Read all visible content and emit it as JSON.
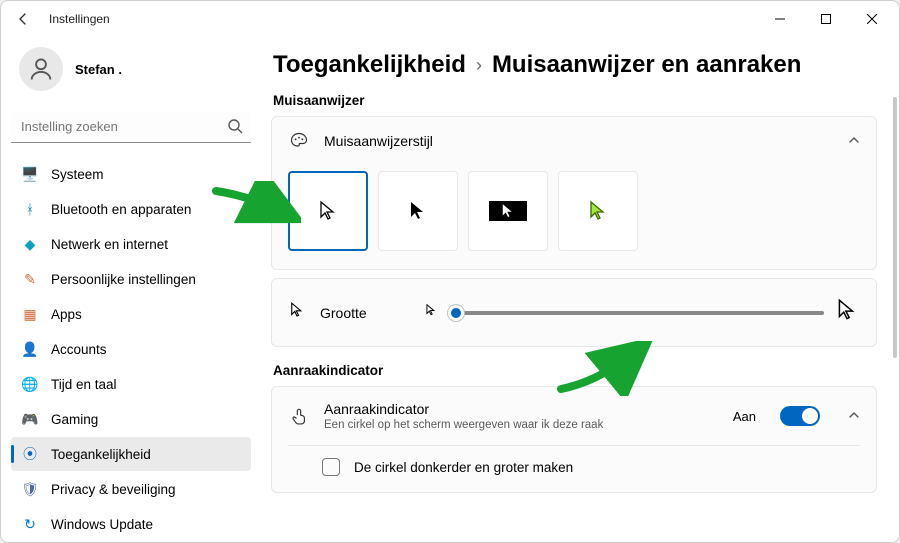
{
  "window": {
    "title": "Instellingen"
  },
  "profile": {
    "name": "Stefan ."
  },
  "search": {
    "placeholder": "Instelling zoeken"
  },
  "sidebar": {
    "items": [
      {
        "icon": "🖥️",
        "color": "#0078d4",
        "label": "Systeem"
      },
      {
        "icon": "ᚼ",
        "color": "#0078d4",
        "label": "Bluetooth en apparaten"
      },
      {
        "icon": "◆",
        "color": "#0aa2c0",
        "label": "Netwerk en internet"
      },
      {
        "icon": "✎",
        "color": "#d06a3e",
        "label": "Persoonlijke instellingen"
      },
      {
        "icon": "▦",
        "color": "#d06a3e",
        "label": "Apps"
      },
      {
        "icon": "👤",
        "color": "#c79a5a",
        "label": "Accounts"
      },
      {
        "icon": "🌐",
        "color": "#5a8a5a",
        "label": "Tijd en taal"
      },
      {
        "icon": "🎮",
        "color": "#7a7a7a",
        "label": "Gaming"
      },
      {
        "icon": "⦿",
        "color": "#0067c0",
        "label": "Toegankelijkheid"
      },
      {
        "icon": "🛡",
        "color": "#4a6aa0",
        "label": "Privacy & beveiliging"
      },
      {
        "icon": "↻",
        "color": "#0078d4",
        "label": "Windows Update"
      }
    ],
    "active_index": 8
  },
  "breadcrumb": {
    "parent": "Toegankelijkheid",
    "current": "Muisaanwijzer en aanraken"
  },
  "sections": {
    "pointer": {
      "title": "Muisaanwijzer",
      "style_label": "Muisaanwijzerstijl",
      "size_label": "Grootte"
    },
    "touch": {
      "title": "Aanraakindicator",
      "row_label": "Aanraakindicator",
      "row_sub": "Een cirkel op het scherm weergeven waar ik deze raak",
      "toggle_state": "Aan",
      "sub_option": "De cirkel donkerder en groter maken"
    }
  },
  "pointer_styles": {
    "selected_index": 0
  },
  "slider": {
    "value_pct": 2
  }
}
